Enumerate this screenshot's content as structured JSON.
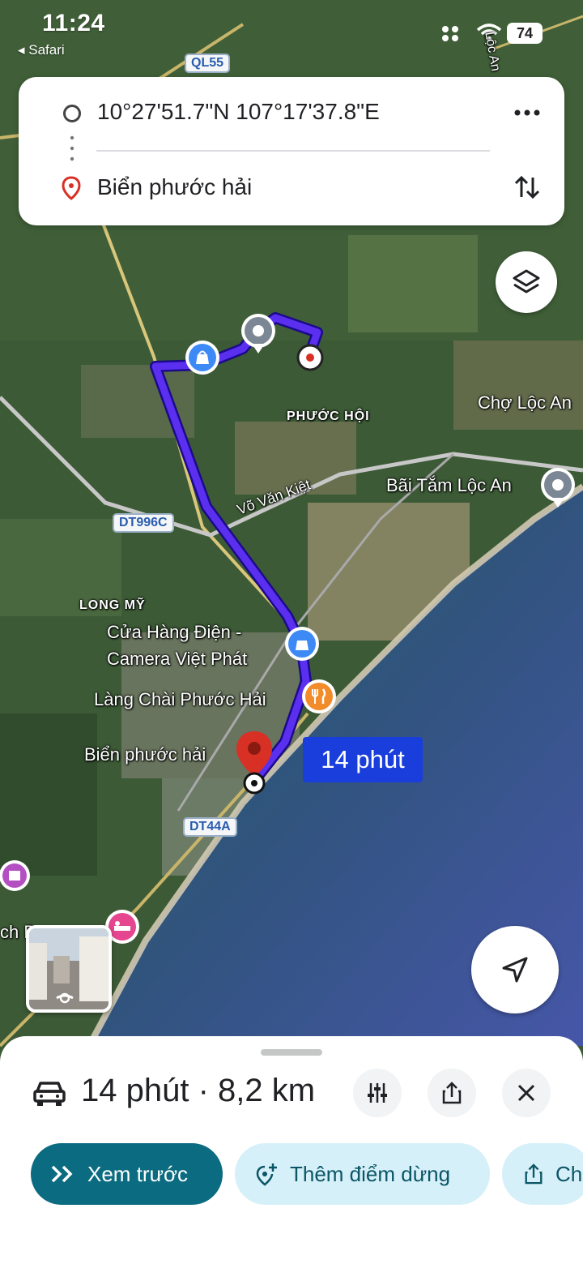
{
  "status_bar": {
    "time": "11:24",
    "back_app": "◂ Safari",
    "battery": "74"
  },
  "route": {
    "origin": "10°27'51.7\"N 107°17'37.8\"E",
    "destination": "Biển phước hải",
    "more_icon": "more-horizontal-icon",
    "swap_icon": "swap-vertical-icon"
  },
  "map": {
    "road_shields": [
      "QL55",
      "DT996C",
      "DT44A"
    ],
    "labels": {
      "phuoc_hoi": "PHƯỚC HỘI",
      "cho_loc_an": "Chợ Lộc An",
      "bai_tam_loc_an": "Bãi Tắm Lộc An",
      "vo_van_kiet": "Võ Văn Kiệt",
      "long_my": "LONG MỸ",
      "cua_hang_dien_1": "Cửa Hàng Điện -",
      "cua_hang_dien_2": "Camera Việt Phát",
      "lang_chai": "Làng Chài Phước Hải",
      "bien_phuoc_hai": "Biển phước hải",
      "loc_an_edge": "Lộc An",
      "partial_left": "ch B"
    },
    "route_color": "#4a1fe0",
    "duration_tag": "14 phút"
  },
  "sheet": {
    "summary": "14 phút · 8,2 km",
    "buttons": {
      "preview": "Xem trước",
      "add_stop": "Thêm điểm dừng",
      "share_partial": "Ch"
    }
  },
  "colors": {
    "accent_primary": "#0b6b80",
    "chip_secondary_bg": "#d5f0f8",
    "destination_pin": "#d93025"
  }
}
